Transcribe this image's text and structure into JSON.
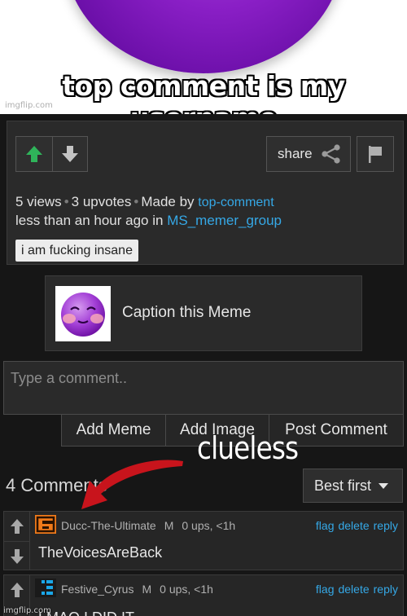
{
  "meme": {
    "caption": "top comment is my username",
    "watermark": "imgflip.com",
    "overlay_text": "clueless"
  },
  "post": {
    "share_label": "share",
    "views": "5 views",
    "upvotes": "3 upvotes",
    "made_by_prefix": "Made by",
    "author": "top-comment",
    "time_prefix": "less than an hour ago in",
    "group": "MS_memer_group",
    "tag": "i am fucking insane"
  },
  "caption_meme": {
    "label": "Caption this Meme"
  },
  "comment_form": {
    "placeholder": "Type a comment..",
    "add_meme": "Add Meme",
    "add_image": "Add Image",
    "post_comment": "Post Comment"
  },
  "comments_header": {
    "count": "4 Comments",
    "sort": "Best first"
  },
  "comments": [
    {
      "user": "Ducc-The-Ultimate",
      "gender": "M",
      "stats": "0 ups, <1h",
      "body": "TheVoicesAreBack",
      "flag": "flag",
      "delete": "delete",
      "reply": "reply"
    },
    {
      "user": "Festive_Cyrus",
      "gender": "M",
      "stats": "0 ups, <1h",
      "body": "LMAO I DID IT",
      "flag": "flag",
      "delete": "delete",
      "reply": "reply"
    }
  ],
  "colors": {
    "link": "#35a8e6",
    "upvote_green": "#2fb45a",
    "background": "#161616",
    "arrow_red": "#c8141c"
  }
}
